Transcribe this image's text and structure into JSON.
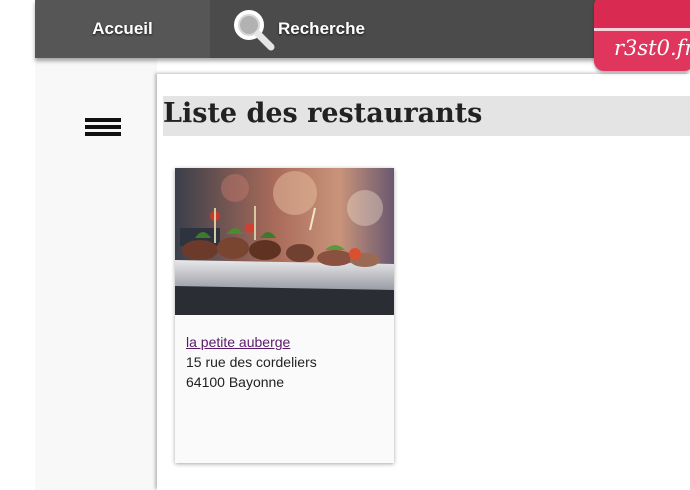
{
  "nav": {
    "home_label": "Accueil",
    "search_label": "Recherche",
    "search_icon": "search-icon"
  },
  "logo": {
    "text": "r3st0.fr"
  },
  "sidebar": {
    "menu_icon": "hamburger-menu-icon"
  },
  "main": {
    "title": "Liste des restaurants",
    "restaurants": [
      {
        "name": "la petite auberge",
        "street": "15 rue des cordeliers",
        "city": "64100 Bayonne",
        "image": "food-photo"
      }
    ]
  },
  "colors": {
    "topbar": "#4b4b4b",
    "logo": "#e0355c",
    "link": "#5a1a6b",
    "title_band": "#e4e4e4"
  }
}
